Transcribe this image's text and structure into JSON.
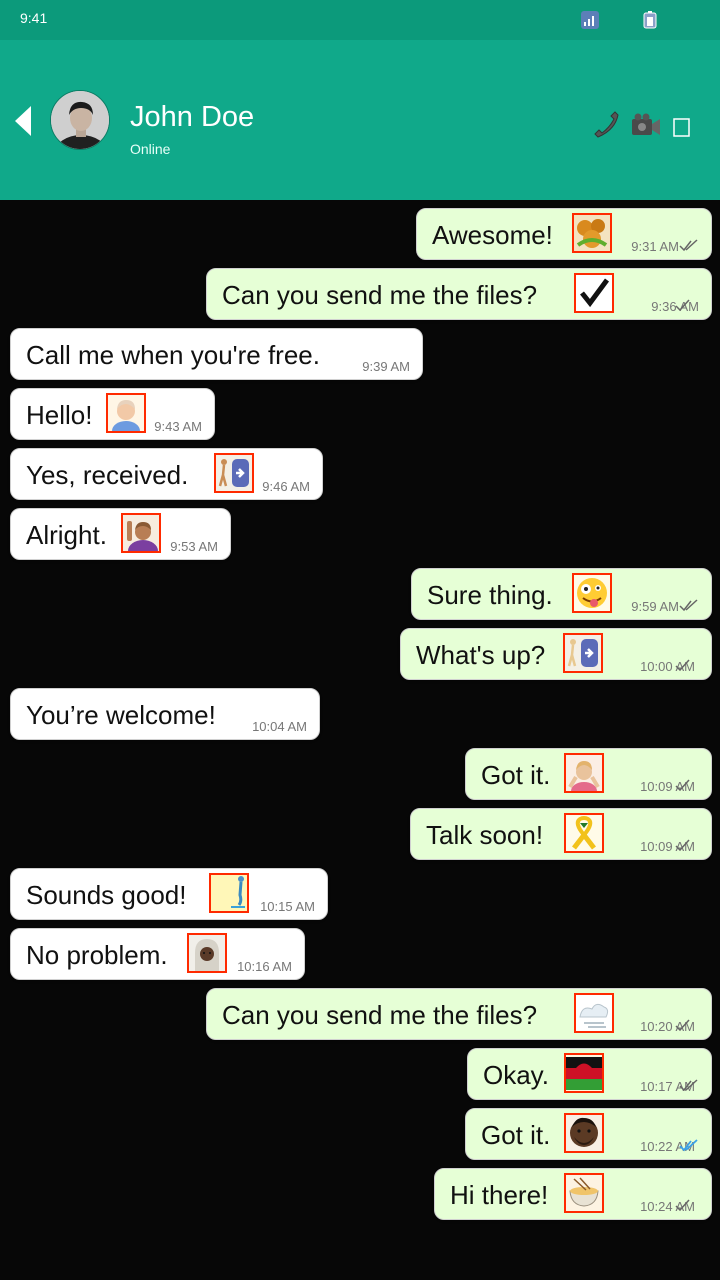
{
  "status_bar": {
    "time": "9:41"
  },
  "contact": {
    "name": "John Doe",
    "status": "Online"
  },
  "messages": [
    {
      "text": "Awesome!",
      "time": "9:31 AM",
      "emoji": "avocado-food-emoji"
    },
    {
      "text": "Can you send me the files?",
      "time": "9:36 AM",
      "emoji": "check-mark-emoji"
    },
    {
      "text": "Call me when you're free.",
      "time": "9:39 AM"
    },
    {
      "text": "Hello!",
      "time": "9:43 AM",
      "emoji": "man-emoji"
    },
    {
      "text": "Yes, received.",
      "time": "9:46 AM",
      "emoji": "walking-right-emoji"
    },
    {
      "text": "Alright.",
      "time": "9:53 AM",
      "emoji": "raising-hand-emoji"
    },
    {
      "text": "Sure thing.",
      "time": "9:59 AM",
      "emoji": "zany-face-emoji"
    },
    {
      "text": "What's up?",
      "time": "10:00 AM",
      "emoji": "walking-right-emoji"
    },
    {
      "text": "You’re welcome!",
      "time": "10:04 AM"
    },
    {
      "text": "Got it.",
      "time": "10:09 AM",
      "emoji": "no-gesture-emoji"
    },
    {
      "text": "Talk soon!",
      "time": "10:09 AM",
      "emoji": "yellow-ribbon-emoji"
    },
    {
      "text": "Sounds good!",
      "time": "10:15 AM",
      "emoji": "person-in-water-emoji"
    },
    {
      "text": "No problem.",
      "time": "10:16 AM",
      "emoji": "woman-with-headscarf-emoji"
    },
    {
      "text": "Can you send me the files?",
      "time": "10:20 AM",
      "emoji": "dashing-away-emoji"
    },
    {
      "text": "Okay.",
      "time": "10:17 AM",
      "emoji": "malawi-flag-emoji"
    },
    {
      "text": "Got it.",
      "time": "10:22 AM",
      "emoji": "man-dark-skin-emoji",
      "read": true
    },
    {
      "text": "Hi there!",
      "time": "10:24 AM",
      "emoji": "ramen-bowl-emoji"
    }
  ],
  "colors": {
    "header": "#10a98a",
    "status_bar": "#0c9a7b",
    "incoming_bubble": "#ffffff",
    "outgoing_bubble": "#e6ffd6",
    "chat_background": "#070707",
    "read_tick": "#3aa1e8"
  }
}
